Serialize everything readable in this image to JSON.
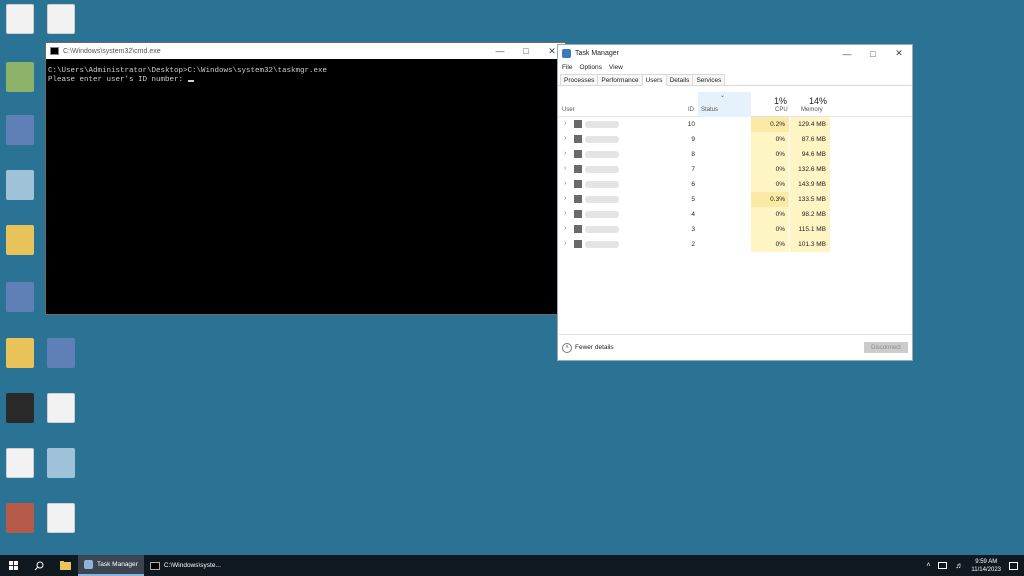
{
  "cmd": {
    "title": "C:\\Windows\\system32\\cmd.exe",
    "line1": "C:\\Users\\Administrator\\Desktop>C:\\Windows\\system32\\taskmgr.exe",
    "line2": "Please enter user's ID number: "
  },
  "taskmanager": {
    "title": "Task Manager",
    "menu": [
      "File",
      "Options",
      "View"
    ],
    "tabs": [
      "Processes",
      "Performance",
      "Users",
      "Details",
      "Services"
    ],
    "active_tab": "Users",
    "columns": {
      "user": "User",
      "id": "ID",
      "status": "Status",
      "cpu": "CPU",
      "memory": "Memory"
    },
    "cpu_total": "1%",
    "memory_total": "14%",
    "rows": [
      {
        "id": "10",
        "cpu": "0.2%",
        "memory": "129.4 MB"
      },
      {
        "id": "9",
        "cpu": "0%",
        "memory": "87.6 MB"
      },
      {
        "id": "8",
        "cpu": "0%",
        "memory": "94.6 MB"
      },
      {
        "id": "7",
        "cpu": "0%",
        "memory": "132.6 MB"
      },
      {
        "id": "6",
        "cpu": "0%",
        "memory": "143.9 MB"
      },
      {
        "id": "5",
        "cpu": "0.3%",
        "memory": "133.5 MB"
      },
      {
        "id": "4",
        "cpu": "0%",
        "memory": "98.2 MB"
      },
      {
        "id": "3",
        "cpu": "0%",
        "memory": "115.1 MB"
      },
      {
        "id": "2",
        "cpu": "0%",
        "memory": "101.3 MB"
      }
    ],
    "fewer_details": "Fewer details",
    "disconnect": "Disconnect"
  },
  "taskbar": {
    "apps": [
      "Task Manager",
      "C:\\Windows\\syste..."
    ],
    "time": "9:59 AM",
    "date": "11/14/2023"
  }
}
